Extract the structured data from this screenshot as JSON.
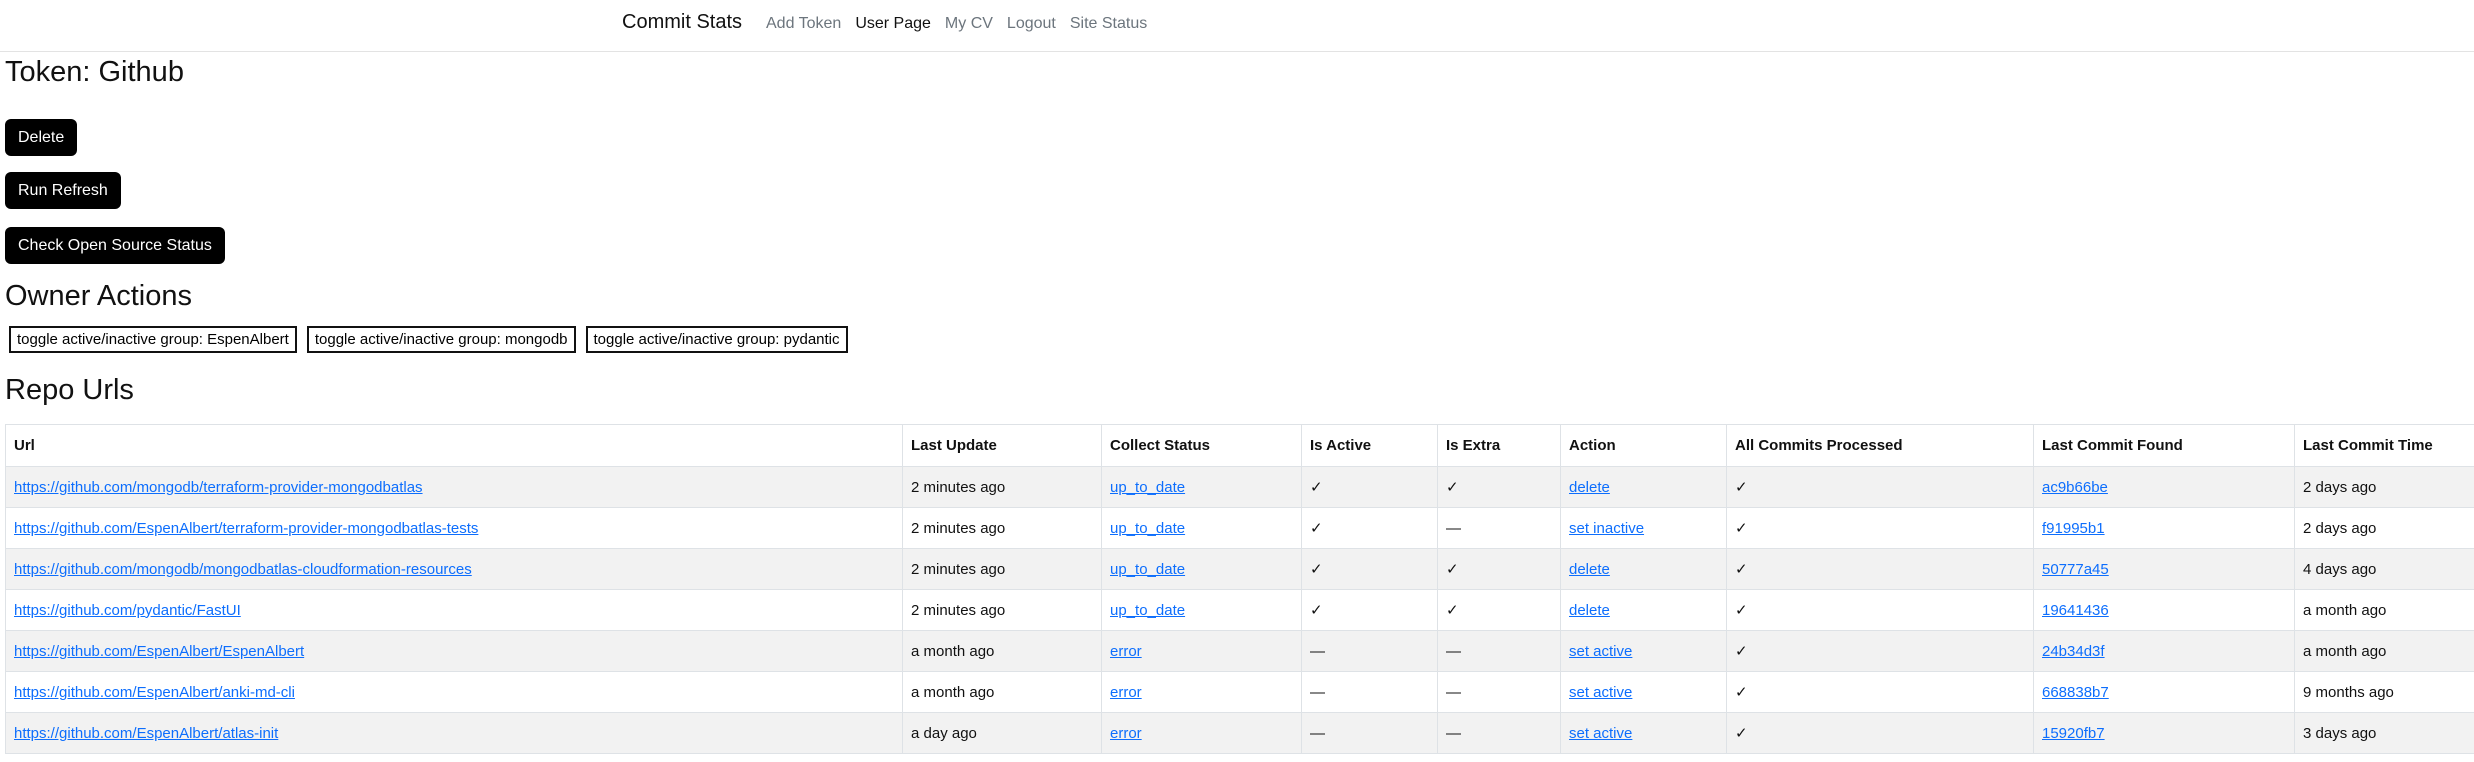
{
  "nav": {
    "brand": "Commit Stats",
    "links": [
      {
        "label": "Add Token"
      },
      {
        "label": "User Page"
      },
      {
        "label": "My CV"
      },
      {
        "label": "Logout"
      },
      {
        "label": "Site Status"
      }
    ]
  },
  "page": {
    "title": "Token: Github",
    "buttons": {
      "delete": "Delete",
      "run_refresh": "Run Refresh",
      "check_open_source": "Check Open Source Status"
    }
  },
  "owner_actions": {
    "title": "Owner Actions",
    "buttons": [
      "toggle active/inactive group: EspenAlbert",
      "toggle active/inactive group: mongodb",
      "toggle active/inactive group: pydantic"
    ]
  },
  "repo_urls": {
    "title": "Repo Urls",
    "columns": [
      "Url",
      "Last Update",
      "Collect Status",
      "Is Active",
      "Is Extra",
      "Action",
      "All Commits Processed",
      "Last Commit Found",
      "Last Commit Time"
    ],
    "rows": [
      {
        "url": "https://github.com/mongodb/terraform-provider-mongodbatlas",
        "last_update": "2 minutes ago",
        "collect_status": "up_to_date",
        "is_active": "✓",
        "is_extra": "✓",
        "action": "delete",
        "all_commits": "✓",
        "last_commit": "ac9b66be",
        "last_commit_time": "2 days ago"
      },
      {
        "url": "https://github.com/EspenAlbert/terraform-provider-mongodbatlas-tests",
        "last_update": "2 minutes ago",
        "collect_status": "up_to_date",
        "is_active": "✓",
        "is_extra": "—",
        "action": "set inactive",
        "all_commits": "✓",
        "last_commit": "f91995b1",
        "last_commit_time": "2 days ago"
      },
      {
        "url": "https://github.com/mongodb/mongodbatlas-cloudformation-resources",
        "last_update": "2 minutes ago",
        "collect_status": "up_to_date",
        "is_active": "✓",
        "is_extra": "✓",
        "action": "delete",
        "all_commits": "✓",
        "last_commit": "50777a45",
        "last_commit_time": "4 days ago"
      },
      {
        "url": "https://github.com/pydantic/FastUI",
        "last_update": "2 minutes ago",
        "collect_status": "up_to_date",
        "is_active": "✓",
        "is_extra": "✓",
        "action": "delete",
        "all_commits": "✓",
        "last_commit": "19641436",
        "last_commit_time": "a month ago"
      },
      {
        "url": "https://github.com/EspenAlbert/EspenAlbert",
        "last_update": "a month ago",
        "collect_status": "error",
        "is_active": "—",
        "is_extra": "—",
        "action": "set active",
        "all_commits": "✓",
        "last_commit": "24b34d3f",
        "last_commit_time": "a month ago"
      },
      {
        "url": "https://github.com/EspenAlbert/anki-md-cli",
        "last_update": "a month ago",
        "collect_status": "error",
        "is_active": "—",
        "is_extra": "—",
        "action": "set active",
        "all_commits": "✓",
        "last_commit": "668838b7",
        "last_commit_time": "9 months ago"
      },
      {
        "url": "https://github.com/EspenAlbert/atlas-init",
        "last_update": "a day ago",
        "collect_status": "error",
        "is_active": "—",
        "is_extra": "—",
        "action": "set active",
        "all_commits": "✓",
        "last_commit": "15920fb7",
        "last_commit_time": "3 days ago"
      }
    ]
  },
  "colors": {
    "link": "#0d6efd",
    "button_bg": "#000000",
    "row_stripe": "#f2f2f2"
  }
}
